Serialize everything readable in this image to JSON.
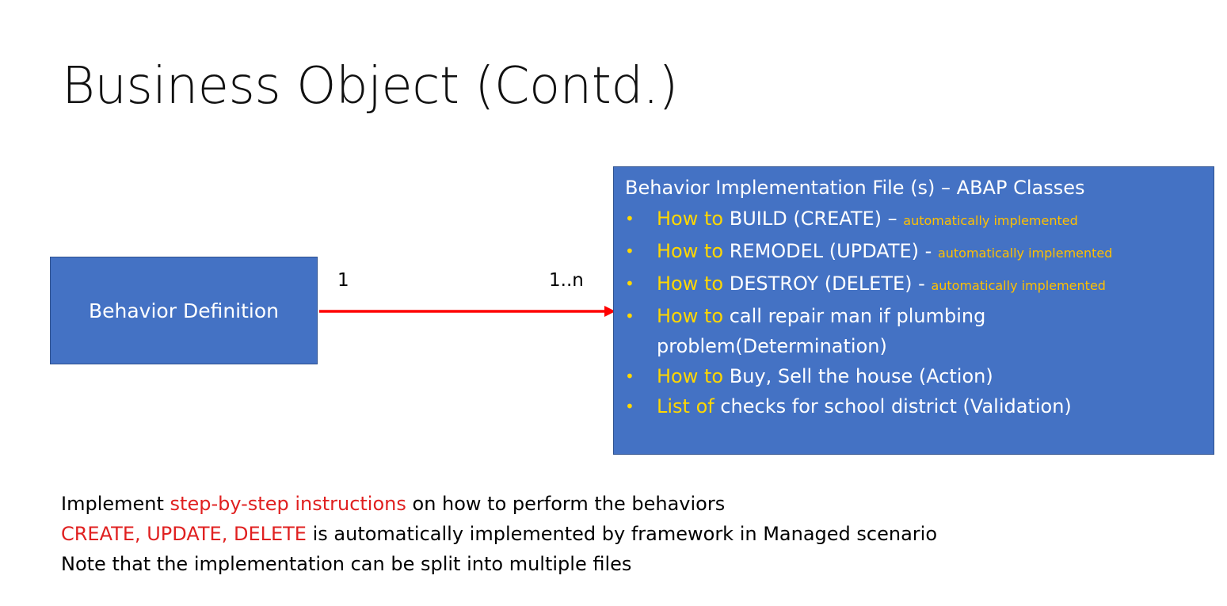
{
  "title": "Business Object (Contd.)",
  "left_box": {
    "label": "Behavior Definition"
  },
  "connector": {
    "left_multiplicity": "1",
    "right_multiplicity": "1..n",
    "color": "#ff0000"
  },
  "right_box": {
    "header": "Behavior Implementation File (s) – ABAP Classes",
    "items": [
      {
        "lead": "How to",
        "text": " BUILD (CREATE) – ",
        "note": "automatically implemented"
      },
      {
        "lead": "How to",
        "text": " REMODEL (UPDATE) - ",
        "note": "automatically implemented"
      },
      {
        "lead": "How to",
        "text": " DESTROY (DELETE) - ",
        "note": "automatically implemented"
      },
      {
        "lead": "How to",
        "text": " call repair man if plumbing problem(Determination)",
        "note": ""
      },
      {
        "lead": "How to",
        "text": " Buy, Sell the house (Action)",
        "note": ""
      },
      {
        "lead": "List of",
        "text": " checks for school district (Validation)",
        "note": ""
      }
    ]
  },
  "footer": {
    "line1_pre": "Implement ",
    "line1_red": "step-by-step instructions",
    "line1_post": " on how to perform the behaviors",
    "line2_red": "CREATE, UPDATE, DELETE",
    "line2_post": " is automatically implemented by framework in Managed scenario",
    "line3": "Note that the implementation can be split into multiple files"
  },
  "colors": {
    "box": "#4472c4",
    "highlight": "#ffd700",
    "note": "#ffc000",
    "emphasis": "#e02020"
  }
}
